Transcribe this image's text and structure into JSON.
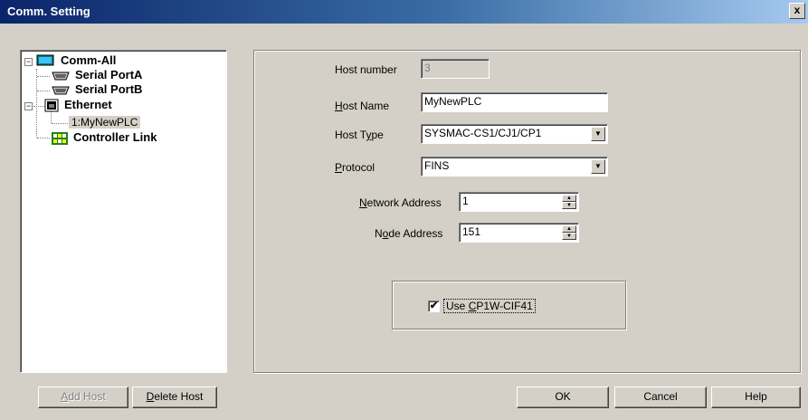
{
  "window": {
    "title": "Comm. Setting",
    "close_label": "x"
  },
  "tree": {
    "root": "Comm-All",
    "serial_a": "Serial PortA",
    "serial_b": "Serial PortB",
    "ethernet": "Ethernet",
    "host": "1:MyNewPLC",
    "controller_link": "Controller Link",
    "colors": {
      "selected_bg": "#d4d0c8"
    },
    "icons": [
      "monitor-icon",
      "serial-port-icon",
      "ethernet-icon",
      "controller-link-icon"
    ]
  },
  "form": {
    "host_number": {
      "label": "Host number",
      "value": "3"
    },
    "host_name": {
      "label_pre": "",
      "label_u": "H",
      "label_post": "ost Name",
      "value": "MyNewPLC"
    },
    "host_type": {
      "label_pre": "Host T",
      "label_u": "y",
      "label_post": "pe",
      "value": "SYSMAC-CS1/CJ1/CP1"
    },
    "protocol": {
      "label_pre": "",
      "label_u": "P",
      "label_post": "rotocol",
      "value": "FINS"
    },
    "network_address": {
      "label_pre": "",
      "label_u": "N",
      "label_post": "etwork Address",
      "value": "1"
    },
    "node_address": {
      "label_pre": "N",
      "label_u": "o",
      "label_post": "de Address",
      "value": "151"
    },
    "use_cif": {
      "label_pre": "Use ",
      "label_u": "C",
      "label_post": "P1W-CIF41",
      "checked": true,
      "check_mark": "✔"
    }
  },
  "buttons": {
    "add_host": {
      "u": "A",
      "rest": "dd Host"
    },
    "delete_host": {
      "u": "D",
      "rest": "elete Host"
    },
    "ok": "OK",
    "cancel": "Cancel",
    "help": "Help"
  }
}
